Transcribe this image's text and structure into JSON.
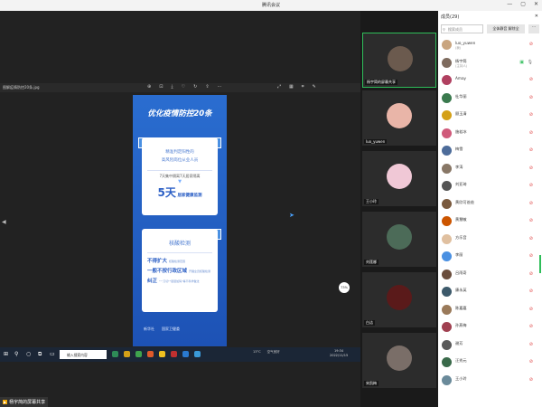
{
  "window": {
    "title": "腾讯会议",
    "controls": [
      "—",
      "▢",
      "✕"
    ]
  },
  "share": {
    "file_name": "图解疫情防控20条.jpg",
    "tool_icons": [
      "zoom-in-icon",
      "fit-icon",
      "download-icon",
      "heart-icon",
      "rotate-icon",
      "share-icon",
      "more-icon"
    ],
    "view_icons": [
      "expand-icon",
      "grid-icon",
      "crop-icon"
    ],
    "cpu_label": "73%",
    "sharer_label": "杨宇简的屏幕共享"
  },
  "poster": {
    "headline": "优化疫情防控20条",
    "card1_line1": "精准判定阳性的",
    "card1_line2": "高风险岗位从业人员",
    "card1_days": "7天集中隔离7天居家隔离",
    "card1_days_num_a": "7",
    "card1_days_num_b": "7",
    "card1_monitor": "5天",
    "card1_monitor_text": "居家健康监测",
    "card2_head": "核酸检测",
    "card2_l1": "不得扩大",
    "card2_l1_small": "核酸检测范围",
    "card2_l2": "一般不按行政区域",
    "card2_l2_small": "开展全员核酸检测",
    "card2_l3": "纠正",
    "card2_l3_small": "\"一刀切\"\"层层加码\"等不科学做法",
    "foot_a": "新华社",
    "foot_b": "国家卫健委"
  },
  "taskbar": {
    "search_placeholder": "输入搜索内容",
    "tray_a": "13°C",
    "tray_b": "空气良好",
    "clock_time": "19:34",
    "clock_date": "2022/11/15"
  },
  "tiles": [
    {
      "name": "杨宇简的屏幕共享",
      "color": "#6b5a4e"
    },
    {
      "name": "luo_yuwen",
      "color": "#e9b5a8"
    },
    {
      "name": "王小玲",
      "color": "#f0c8d6"
    },
    {
      "name": "刘莲娜",
      "color": "#4c6b58"
    },
    {
      "name": "白洁",
      "color": "#5a1a1a"
    },
    {
      "name": "宋凯梅",
      "color": "#7a6e68"
    }
  ],
  "panel": {
    "title": "成员(29)",
    "close": "✕",
    "search_placeholder": "搜索成员",
    "mute_all": "全体静音 解除全",
    "more": "···",
    "members": [
      {
        "name": "luo_yuwen",
        "role": "(我)",
        "color": "#c9a57f",
        "mic": "off",
        "cam": false
      },
      {
        "name": "杨宇简",
        "role": "(主持人)",
        "color": "#7e6b5e",
        "mic": "on",
        "cam": true
      },
      {
        "name": "Amay",
        "role": "",
        "color": "#b04060",
        "mic": "off",
        "cam": false
      },
      {
        "name": "杜华丽",
        "role": "",
        "color": "#3a7a4e",
        "mic": "off",
        "cam": false
      },
      {
        "name": "顾玉清",
        "role": "",
        "color": "#d4a017",
        "mic": "off",
        "cam": false
      },
      {
        "name": "施若冰",
        "role": "",
        "color": "#d05a7a",
        "mic": "off",
        "cam": false
      },
      {
        "name": "梅雪",
        "role": "",
        "color": "#4d6c9a",
        "mic": "off",
        "cam": false
      },
      {
        "name": "李涛",
        "role": "",
        "color": "#887766",
        "mic": "off",
        "cam": false
      },
      {
        "name": "刘亚琦",
        "role": "",
        "color": "#555555",
        "mic": "off",
        "cam": false
      },
      {
        "name": "黄欣可爸爸",
        "role": "",
        "color": "#7a5a3e",
        "mic": "off",
        "cam": false
      },
      {
        "name": "黄慧敏",
        "role": "",
        "color": "#cc5500",
        "mic": "off",
        "cam": false
      },
      {
        "name": "方乐音",
        "role": "",
        "color": "#e0c0a0",
        "mic": "off",
        "cam": false
      },
      {
        "name": "李丽",
        "role": "",
        "color": "#4a90e2",
        "mic": "off",
        "cam": false
      },
      {
        "name": "吕雨奇",
        "role": "",
        "color": "#6b4e3d",
        "mic": "off",
        "cam": false
      },
      {
        "name": "康永英",
        "role": "",
        "color": "#3d5a6b",
        "mic": "off",
        "cam": false
      },
      {
        "name": "陈嘉嘉",
        "role": "",
        "color": "#9a7a5a",
        "mic": "off",
        "cam": false
      },
      {
        "name": "孙燕梅",
        "role": "",
        "color": "#a04050",
        "mic": "off",
        "cam": false
      },
      {
        "name": "谢芳",
        "role": "",
        "color": "#5a5a5a",
        "mic": "off",
        "cam": false
      },
      {
        "name": "汪秀元",
        "role": "",
        "color": "#3a6a4a",
        "mic": "off",
        "cam": false
      },
      {
        "name": "王小玲",
        "role": "",
        "color": "#6a8a9a",
        "mic": "off",
        "cam": false
      }
    ]
  }
}
